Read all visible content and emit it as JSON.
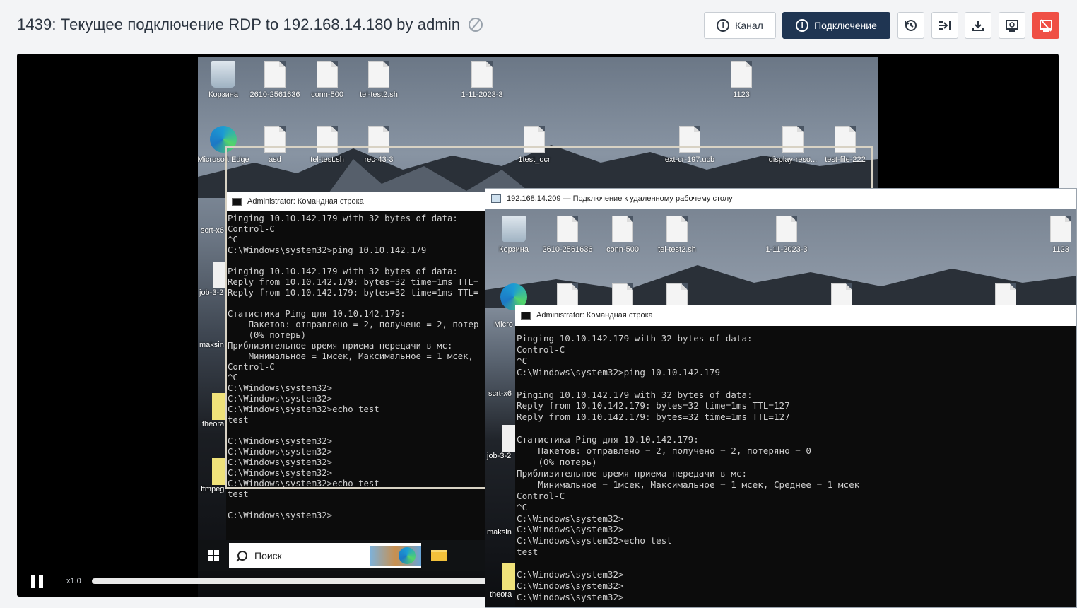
{
  "header": {
    "title": "1439: Текущее подключение RDP to 192.168.14.180 by admin",
    "buttons": {
      "channel": "Канал",
      "connection": "Подключение"
    }
  },
  "colors": {
    "primary": "#1f3552",
    "danger": "#ef4f45"
  },
  "desktop": {
    "row1": [
      "Корзина",
      "2610-2561636",
      "conn-500",
      "tel-test2.sh",
      "1-11-2023-3",
      "1123"
    ],
    "row2": [
      "Microsoft Edge",
      "asd",
      "tel-test.sh",
      "rec-43-3",
      "1test_ocr",
      "ext-cr-197.ucb",
      "display-reso...",
      "test-file-222"
    ],
    "side": [
      "scrt-x6",
      "job-3-2",
      "maksin",
      "theora",
      "ffmpeg"
    ]
  },
  "cmd1": {
    "title": "Administrator: Командная строка",
    "lines": [
      "Pinging 10.10.142.179 with 32 bytes of data:",
      "Control-C",
      "^C",
      "C:\\Windows\\system32>ping 10.10.142.179",
      "",
      "Pinging 10.10.142.179 with 32 bytes of data:",
      "Reply from 10.10.142.179: bytes=32 time=1ms TTL=",
      "Reply from 10.10.142.179: bytes=32 time=1ms TTL=",
      "",
      "Статистика Ping для 10.10.142.179:",
      "    Пакетов: отправлено = 2, получено = 2, потер",
      "    (0% потерь)",
      "Приблизительное время приема-передачи в мс:",
      "    Минимальное = 1мсек, Максимальное = 1 мсек, ",
      "Control-C",
      "^C",
      "C:\\Windows\\system32>",
      "C:\\Windows\\system32>",
      "C:\\Windows\\system32>echo test",
      "test",
      "",
      "C:\\Windows\\system32>",
      "C:\\Windows\\system32>",
      "C:\\Windows\\system32>",
      "C:\\Windows\\system32>",
      "C:\\Windows\\system32>echo test",
      "test",
      "",
      "C:\\Windows\\system32>_"
    ]
  },
  "taskbar": {
    "search": "Поиск"
  },
  "player": {
    "speed": "x1.0"
  },
  "rdp": {
    "title": "192.168.14.209 — Подключение к удаленному рабочему столу",
    "icons": [
      "Корзина",
      "2610-2561636",
      "conn-500",
      "tel-test2.sh",
      "1-11-2023-3",
      "1123"
    ],
    "side": [
      "Micro Edg",
      "scrt-x6",
      "job-3-2",
      "maksin",
      "theora"
    ],
    "cmd_title": "Administrator: Командная строка",
    "lines": [
      "Pinging 10.10.142.179 with 32 bytes of data:",
      "Control-C",
      "^C",
      "C:\\Windows\\system32>ping 10.10.142.179",
      "",
      "Pinging 10.10.142.179 with 32 bytes of data:",
      "Reply from 10.10.142.179: bytes=32 time=1ms TTL=127",
      "Reply from 10.10.142.179: bytes=32 time=1ms TTL=127",
      "",
      "Статистика Ping для 10.10.142.179:",
      "    Пакетов: отправлено = 2, получено = 2, потеряно = 0",
      "    (0% потерь)",
      "Приблизительное время приема-передачи в мс:",
      "    Минимальное = 1мсек, Максимальное = 1 мсек, Среднее = 1 мсек",
      "Control-C",
      "^C",
      "C:\\Windows\\system32>",
      "C:\\Windows\\system32>",
      "C:\\Windows\\system32>echo test",
      "test",
      "",
      "C:\\Windows\\system32>",
      "C:\\Windows\\system32>",
      "C:\\Windows\\system32>"
    ]
  }
}
